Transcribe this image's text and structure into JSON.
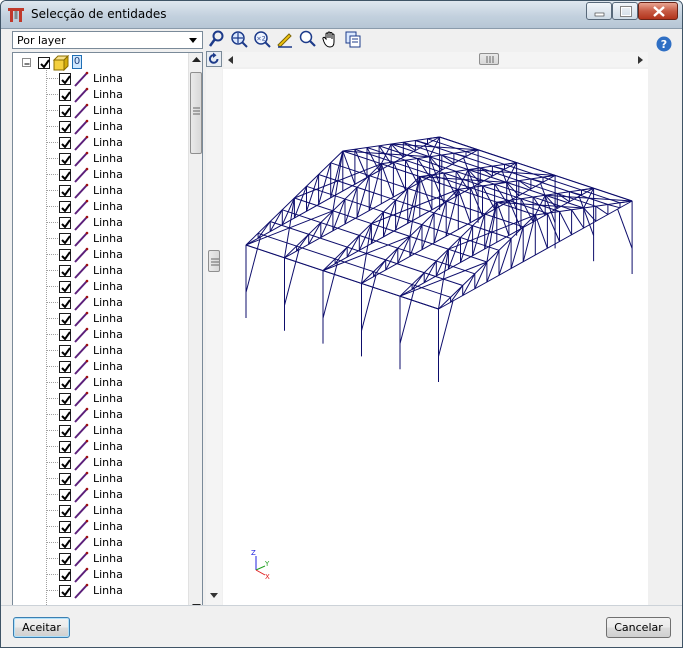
{
  "window": {
    "title": "Selecção de entidades"
  },
  "filter": {
    "selected": "Por layer"
  },
  "tree": {
    "root_layer_label": "0",
    "items": [
      {
        "label": "Linha"
      },
      {
        "label": "Linha"
      },
      {
        "label": "Linha"
      },
      {
        "label": "Linha"
      },
      {
        "label": "Linha"
      },
      {
        "label": "Linha"
      },
      {
        "label": "Linha"
      },
      {
        "label": "Linha"
      },
      {
        "label": "Linha"
      },
      {
        "label": "Linha"
      },
      {
        "label": "Linha"
      },
      {
        "label": "Linha"
      },
      {
        "label": "Linha"
      },
      {
        "label": "Linha"
      },
      {
        "label": "Linha"
      },
      {
        "label": "Linha"
      },
      {
        "label": "Linha"
      },
      {
        "label": "Linha"
      },
      {
        "label": "Linha"
      },
      {
        "label": "Linha"
      },
      {
        "label": "Linha"
      },
      {
        "label": "Linha"
      },
      {
        "label": "Linha"
      },
      {
        "label": "Linha"
      },
      {
        "label": "Linha"
      },
      {
        "label": "Linha"
      },
      {
        "label": "Linha"
      },
      {
        "label": "Linha"
      },
      {
        "label": "Linha"
      },
      {
        "label": "Linha"
      },
      {
        "label": "Linha"
      },
      {
        "label": "Linha"
      },
      {
        "label": "Linha"
      }
    ]
  },
  "toolbar": {
    "icons": [
      "select-icon",
      "zoom-all-icon",
      "zoom-factor-icon",
      "zoom-window-icon",
      "zoom-icon",
      "pan-icon",
      "copy-view-icon"
    ],
    "zoom_factor_label": "×2"
  },
  "view": {
    "axis_labels": {
      "z": "Z",
      "y": "Y",
      "x": "X"
    },
    "colors": {
      "structure": "#0d0d6b",
      "axis_x": "#e02020",
      "axis_y": "#20a020",
      "axis_z": "#2020e0"
    }
  },
  "footer": {
    "accept_label": "Aceitar",
    "cancel_label": "Cancelar"
  }
}
